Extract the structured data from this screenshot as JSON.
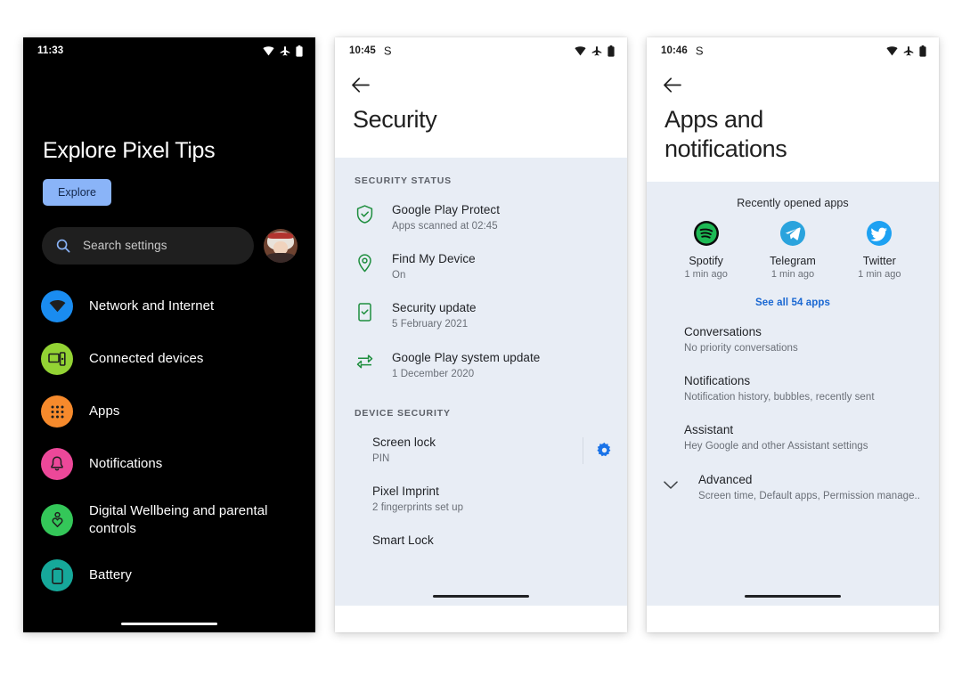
{
  "colors": {
    "page_background": "#ffffff",
    "dark_screen": "#000000",
    "light_body": "#e8edf5",
    "accent_blue": "#8ab4f8",
    "link_blue": "#1967d2",
    "green_status": "#1e8e3e",
    "gear_blue": "#1a73e8"
  },
  "phone1": {
    "status": {
      "time": "11:33",
      "icons": [
        "wifi-icon",
        "airplane-mode-icon",
        "battery-icon"
      ]
    },
    "hero": {
      "title": "Explore Pixel Tips",
      "button_label": "Explore"
    },
    "search": {
      "icon": "search-icon",
      "placeholder": "Search settings",
      "value": ""
    },
    "avatar": "user-avatar",
    "items": [
      {
        "label": "Network and Internet",
        "icon": "wifi-circle-icon",
        "color": "#1a8cf0"
      },
      {
        "label": "Connected devices",
        "icon": "devices-circle-icon",
        "color": "#93d334"
      },
      {
        "label": "Apps",
        "icon": "apps-grid-circle-icon",
        "color": "#f68a2c"
      },
      {
        "label": "Notifications",
        "icon": "bell-circle-icon",
        "color": "#ec4899"
      },
      {
        "label": "Digital Wellbeing and parental controls",
        "icon": "wellbeing-circle-icon",
        "color": "#34c759"
      },
      {
        "label": "Battery",
        "icon": "battery-circle-icon",
        "color": "#16a89a"
      }
    ]
  },
  "phone2": {
    "status": {
      "time": "10:45",
      "notification_icon": "S",
      "icons": [
        "wifi-icon",
        "airplane-mode-icon",
        "battery-icon"
      ]
    },
    "back_icon": "back-arrow-icon",
    "title": "Security",
    "sections": [
      {
        "header": "SECURITY STATUS",
        "rows": [
          {
            "icon": "shield-check-icon",
            "title": "Google Play Protect",
            "subtitle": "Apps scanned at 02:45"
          },
          {
            "icon": "location-pin-icon",
            "title": "Find My Device",
            "subtitle": "On"
          },
          {
            "icon": "phone-update-icon",
            "title": "Security update",
            "subtitle": "5 February 2021"
          },
          {
            "icon": "system-update-icon",
            "title": "Google Play system update",
            "subtitle": "1 December 2020"
          }
        ]
      },
      {
        "header": "DEVICE SECURITY",
        "rows": [
          {
            "icon": "",
            "title": "Screen lock",
            "subtitle": "PIN",
            "trailing_icon": "gear-icon"
          },
          {
            "icon": "",
            "title": "Pixel Imprint",
            "subtitle": "2 fingerprints set up"
          },
          {
            "icon": "",
            "title": "Smart Lock",
            "subtitle": ""
          }
        ]
      }
    ]
  },
  "phone3": {
    "status": {
      "time": "10:46",
      "notification_icon": "S",
      "icons": [
        "wifi-icon",
        "airplane-mode-icon",
        "battery-icon"
      ]
    },
    "back_icon": "back-arrow-icon",
    "title": "Apps and notifications",
    "recent": {
      "header": "Recently opened apps",
      "apps": [
        {
          "name": "Spotify",
          "time": "1 min ago",
          "icon": "spotify-icon"
        },
        {
          "name": "Telegram",
          "time": "1 min ago",
          "icon": "telegram-icon"
        },
        {
          "name": "Twitter",
          "time": "1 min ago",
          "icon": "twitter-icon"
        }
      ],
      "see_all_label": "See all 54 apps"
    },
    "rows": [
      {
        "title": "Conversations",
        "subtitle": "No priority conversations"
      },
      {
        "title": "Notifications",
        "subtitle": "Notification history, bubbles, recently sent"
      },
      {
        "title": "Assistant",
        "subtitle": "Hey Google and other Assistant settings"
      },
      {
        "title": "Advanced",
        "subtitle": "Screen time, Default apps, Permission manage..",
        "leading_icon": "chevron-down-icon"
      }
    ]
  }
}
